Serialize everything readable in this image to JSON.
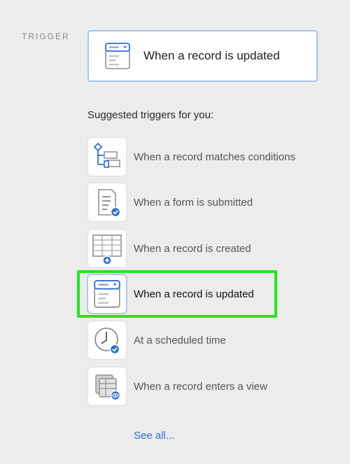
{
  "trigger": {
    "label": "TRIGGER",
    "selected_text": "When a record is updated",
    "icon": "record-updated-icon"
  },
  "suggested": {
    "heading": "Suggested triggers for you:",
    "items": [
      {
        "label": "When a record matches conditions",
        "icon": "conditions-flow-icon"
      },
      {
        "label": "When a form is submitted",
        "icon": "form-submitted-icon"
      },
      {
        "label": "When a record is created",
        "icon": "record-created-icon"
      },
      {
        "label": "When a record is updated",
        "icon": "record-updated-icon",
        "selected": true
      },
      {
        "label": "At a scheduled time",
        "icon": "clock-icon"
      },
      {
        "label": "When a record enters a view",
        "icon": "view-enter-icon"
      }
    ]
  },
  "see_all": "See all...",
  "colors": {
    "accent_blue": "#2d6fd6",
    "icon_gray": "#8f8f8f",
    "highlight_green": "#1ee81e",
    "background": "#ececec"
  }
}
